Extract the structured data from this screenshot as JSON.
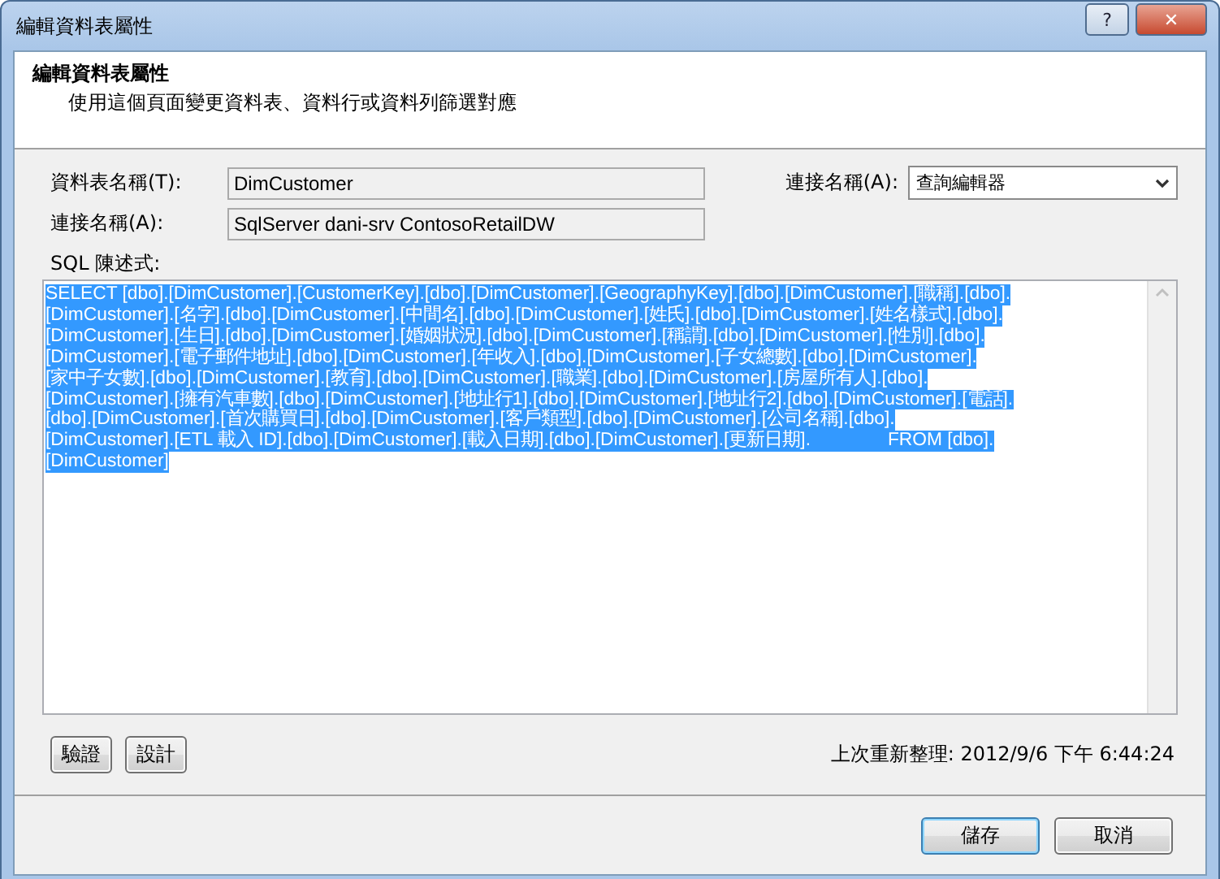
{
  "window": {
    "title": "編輯資料表屬性",
    "controls": [
      {
        "kind": "help",
        "label": "?"
      },
      {
        "kind": "close",
        "label": "✕"
      }
    ]
  },
  "header": {
    "title": "編輯資料表屬性",
    "subtitle": "使用這個頁面變更資料表、資料行或資料列篩選對應"
  },
  "fields": [
    {
      "label": "資料表名稱(T):",
      "value": "DimCustomer"
    },
    {
      "label": "連接名稱(A):",
      "value": "SqlServer dani-srv ContosoRetailDW"
    }
  ],
  "source": {
    "label": "連接名稱(A):",
    "value": "查詢編輯器"
  },
  "sql": {
    "label": "SQL 陳述式:",
    "selected": true,
    "lines": [
      "SELECT [dbo].[DimCustomer].[CustomerKey].[dbo].[DimCustomer].[GeographyKey].[dbo].[DimCustomer].[職稱].[dbo].",
      "[DimCustomer].[名字].[dbo].[DimCustomer].[中間名].[dbo].[DimCustomer].[姓氏].[dbo].[DimCustomer].[姓名樣式].[dbo].",
      "[DimCustomer].[生日].[dbo].[DimCustomer].[婚姻狀況].[dbo].[DimCustomer].[稱謂].[dbo].[DimCustomer].[性別].[dbo].",
      "[DimCustomer].[電子郵件地址].[dbo].[DimCustomer].[年收入].[dbo].[DimCustomer].[子女總數].[dbo].[DimCustomer].",
      "[家中子女數].[dbo].[DimCustomer].[教育].[dbo].[DimCustomer].[職業].[dbo].[DimCustomer].[房屋所有人].[dbo].",
      "[DimCustomer].[擁有汽車數].[dbo].[DimCustomer].[地址行1].[dbo].[DimCustomer].[地址行2].[dbo].[DimCustomer].[電話].",
      "[dbo].[DimCustomer].[首次購買日].[dbo].[DimCustomer].[客戶類型].[dbo].[DimCustomer].[公司名稱].[dbo].",
      "[DimCustomer].[ETL 載入 ID].[dbo].[DimCustomer].[載入日期].[dbo].[DimCustomer].[更新日期].               FROM [dbo].",
      "[DimCustomer]"
    ]
  },
  "tool_buttons": [
    "驗證",
    "設計"
  ],
  "last_refresh": "上次重新整理: 2012/9/6 下午 6:44:24",
  "buttons": [
    {
      "label": "儲存",
      "default": true
    },
    {
      "label": "取消",
      "default": false
    }
  ]
}
